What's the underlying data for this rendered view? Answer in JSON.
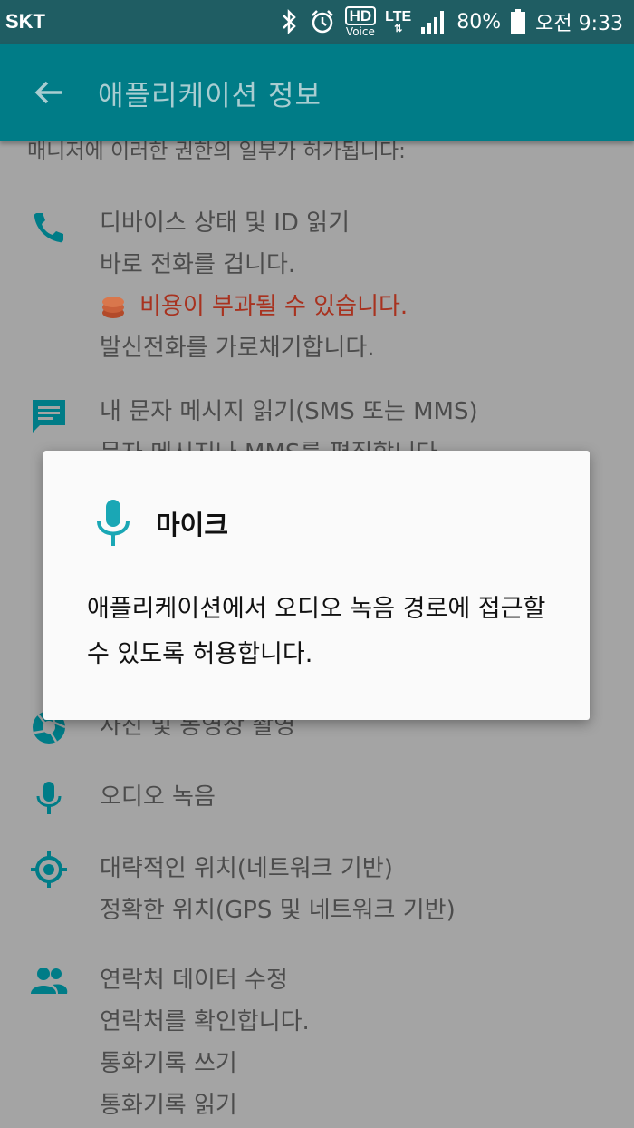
{
  "status_bar": {
    "carrier": "SKT",
    "hd_label": "HD",
    "voice_label": "Voice",
    "network": "LTE",
    "battery": "80%",
    "time": "오전 9:33"
  },
  "app_bar": {
    "title": "애플리케이션 정보"
  },
  "content": {
    "intro_partial": "매니저에 이러한 권한의 일부가 허가됩니다:",
    "permissions": [
      {
        "icon": "phone-icon",
        "lines": [
          "디바이스 상태 및 ID 읽기",
          "바로 전화를 겁니다.",
          "비용이 부과될 수 있습니다.",
          "발신전화를 가로채기합니다."
        ]
      },
      {
        "icon": "message-icon",
        "lines": [
          "내 문자 메시지 읽기(SMS 또는 MMS)",
          "문자 메시지나 MMS를 편집합니다."
        ]
      },
      {
        "icon": "camera-icon",
        "lines": [
          "사진 및 동영상 촬영"
        ]
      },
      {
        "icon": "mic-icon",
        "lines": [
          "오디오 녹음"
        ]
      },
      {
        "icon": "location-icon",
        "lines": [
          "대략적인 위치(네트워크 기반)",
          "정확한 위치(GPS 및 네트워크 기반)"
        ]
      },
      {
        "icon": "contacts-icon",
        "lines": [
          "연락처 데이터 수정",
          "연락처를 확인합니다.",
          "통화기록 쓰기",
          "통화기록 읽기"
        ]
      }
    ]
  },
  "dialog": {
    "icon": "mic-icon",
    "title": "마이크",
    "body": "애플리케이션에서 오디오 녹음 경로에 접근할 수 있도록 허용합니다."
  },
  "colors": {
    "status_bar": "#1f5d63",
    "app_bar": "#007c87",
    "icon_teal": "#007c87",
    "warning": "#a8321f",
    "dialog_mic": "#1aa7b5"
  }
}
